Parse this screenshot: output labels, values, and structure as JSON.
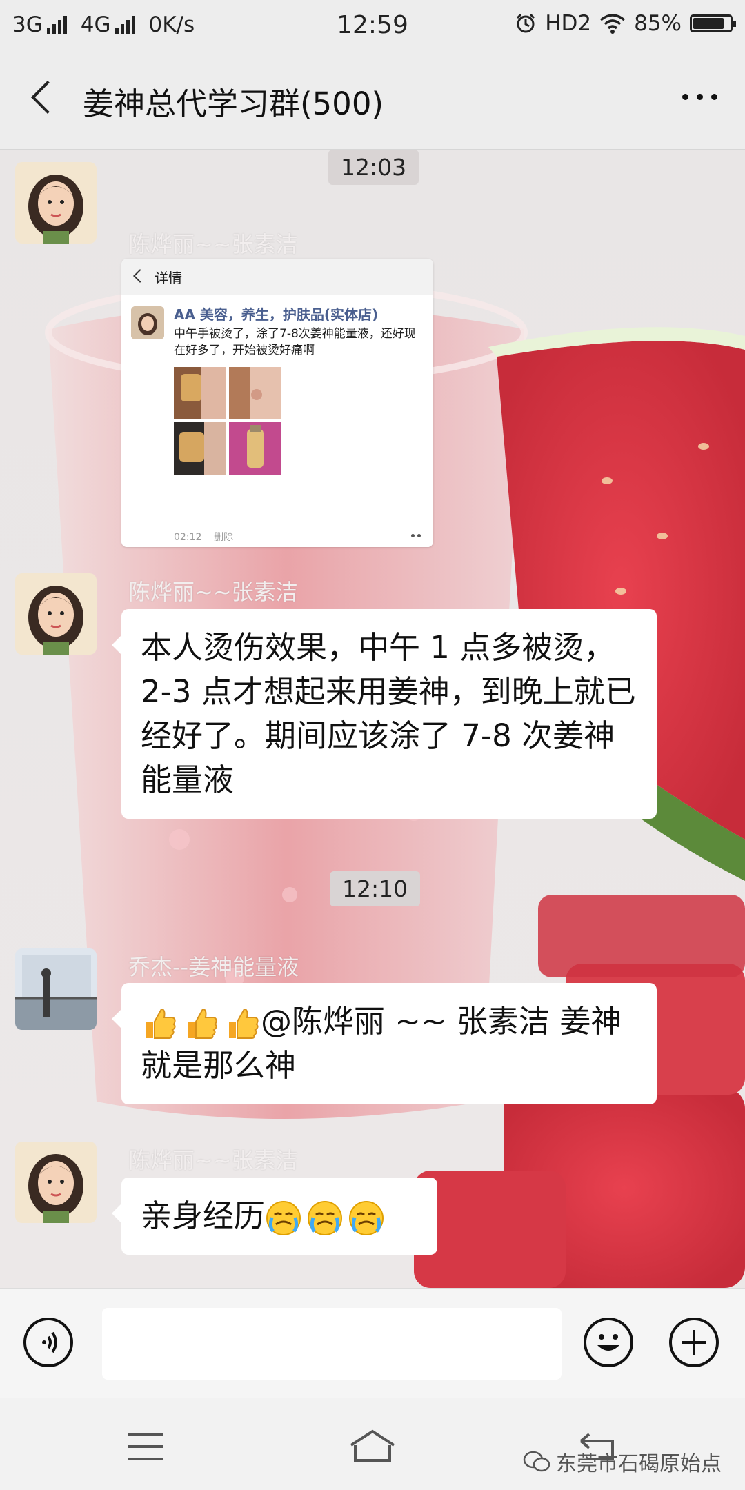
{
  "status_bar": {
    "network_1": "3G",
    "network_2": "4G",
    "speed": "0K/s",
    "time": "12:59",
    "hd": "HD2",
    "battery": "85%",
    "battery_level": 0.85
  },
  "header": {
    "title": "姜神总代学习群(500)"
  },
  "messages": [
    {
      "type": "time",
      "text": "12:03"
    },
    {
      "type": "image",
      "sender": "陈烨丽~~张素洁",
      "screenshot": {
        "header": "详情",
        "post_name": "AA 美容，养生，护肤品(实体店)",
        "post_text": "中午手被烫了，涂了7-8次姜神能量液，还好现在好多了，开始被烫好痛啊",
        "post_time": "02:12",
        "post_action": "删除"
      }
    },
    {
      "type": "text",
      "sender": "陈烨丽~~张素洁",
      "text": "本人烫伤效果，中午 1 点多被烫，2-3 点才想起来用姜神，到晚上就已经好了。期间应该涂了 7-8 次姜神能量液"
    },
    {
      "type": "time",
      "text": "12:10"
    },
    {
      "type": "text",
      "sender": "乔杰--姜神能量液",
      "text": "@陈烨丽 ~~ 张素洁  姜神就是那么神"
    },
    {
      "type": "text",
      "sender": "陈烨丽~~张素洁",
      "text": "亲身经历"
    }
  ],
  "icons": {
    "back": "back-arrow-icon",
    "more": "more-dots-icon",
    "voice": "voice-icon",
    "emoji": "emoji-smile-icon",
    "add": "plus-icon",
    "menu": "menu-icon",
    "home": "home-icon",
    "return": "return-icon"
  },
  "watermark": "东莞市石碣原始点"
}
